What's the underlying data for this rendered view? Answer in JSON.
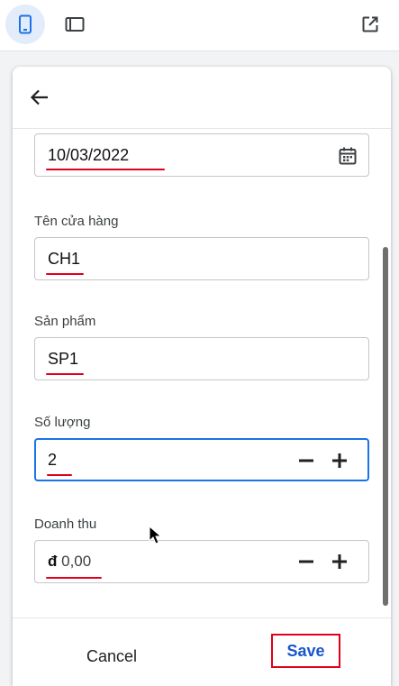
{
  "toolbar": {
    "icons": [
      "phone-icon",
      "tablet-icon",
      "open-in-new-icon"
    ]
  },
  "header": {
    "back_icon": "arrow-left-icon"
  },
  "form": {
    "date_field": {
      "value": "10/03/2022",
      "icon": "calendar-icon"
    },
    "store": {
      "label": "Tên cửa hàng",
      "value": "CH1"
    },
    "product": {
      "label": "Sản phẩm",
      "value": "SP1"
    },
    "quantity": {
      "label": "Số lượng",
      "value": "2"
    },
    "revenue": {
      "label": "Doanh thu",
      "currency": "đ",
      "value": "0,00"
    }
  },
  "footer": {
    "cancel_label": "Cancel",
    "save_label": "Save"
  },
  "colors": {
    "accent": "#1a73e8",
    "annotation": "#e0001b",
    "save_text": "#1a56c9"
  }
}
